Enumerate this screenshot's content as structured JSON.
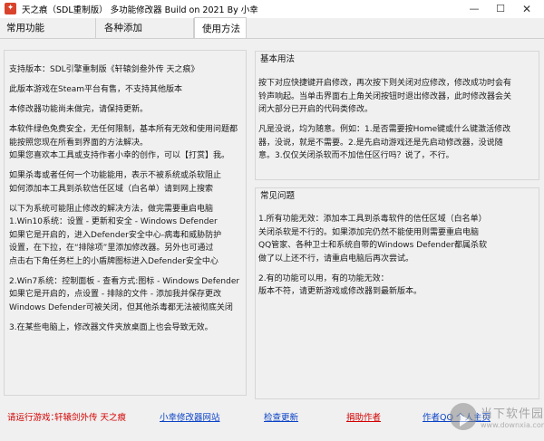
{
  "window": {
    "title": "天之痕（SDL重制版） 多功能修改器  Build on 2021 By 小幸",
    "min_glyph": "—",
    "max_glyph": "☐",
    "close_glyph": "✕"
  },
  "tabs": [
    {
      "label": "常用功能",
      "active": false
    },
    {
      "label": "各种添加",
      "active": false
    },
    {
      "label": "使用方法",
      "active": true
    }
  ],
  "left_panel": {
    "lines": [
      "支持版本：SDL引擎重制版《轩辕剑叁外传 天之痕》",
      "",
      "此版本游戏在Steam平台有售，不支持其他版本",
      "",
      "本修改器功能尚未做完，请保持更新。",
      "",
      "本软件绿色免费安全，无任何限制，基本所有无效和使用问题都",
      "能按照您现在所看到界面的方法解决。",
      "如果您喜欢本工具或支持作者小幸的创作，可以【打赏】我。",
      "",
      "如果杀毒或者任何一个功能能用，表示不被系统或杀软阻止",
      "如何添加本工具到杀软信任区域（白名单）请到网上搜索",
      "",
      "以下为系统可能阻止修改的解决方法，做完需要重启电脑",
      "1.Win10系统：设置 - 更新和安全 - Windows Defender",
      "  如果它是开启的，进入Defender安全中心-病毒和威胁防护",
      "  设置，在下拉，在“排除项”里添加修改器。另外也可通过",
      "  点击右下角任务栏上的小盾牌图标进入Defender安全中心",
      "",
      "2.Win7系统：控制面板 - 查看方式:图标 - Windows Defender",
      "  如果它是开启的，点设置 - 排除的文件 - 添加我并保存更改",
      "  Windows Defender可被关闭，但其他杀毒都无法被彻底关闭",
      "",
      "3.在某些电脑上，修改器文件夹放桌面上也会导致无效。"
    ]
  },
  "basic_usage": {
    "title": "基本用法",
    "lines": [
      "按下对应快捷键开启修改，再次按下则关闭对应修改，修改成功时会有",
      "铃声响起。当单击界面右上角关闭按钮时退出修改器，此时修改器会关",
      "闭大部分已开启的代码类修改。",
      "",
      "凡是没说，均为随意。例如：1.是否需要按Home键或什么键激活修改",
      "器，没说，就是不需要。2.是先启动游戏还是先启动修改器，没说随",
      "意。3.仅仅关闭杀软而不加信任区行吗？说了，不行。"
    ]
  },
  "faq": {
    "title": "常见问题",
    "lines": [
      "1.所有功能无效：添加本工具到杀毒软件的信任区域（白名单）",
      "  关闭杀软是不行的。如果添加完仍然不能使用则需要重启电脑",
      "  QQ管家、各种卫士和系统自带的Windows Defender都属杀软",
      "  做了以上还不行，请重启电脑后再次尝试。",
      "",
      "2.有的功能可以用，有的功能无效：",
      "  版本不符，请更新游戏或修改器到最新版本。"
    ]
  },
  "footer": {
    "running_label": "请运行游戏：",
    "game_name": "轩辕剑外传 天之痕",
    "site_link": "小幸修改器网站",
    "update_link": "检查更新",
    "donate_link": "捐助作者",
    "author_link": "作者QQ  个人主页"
  },
  "watermark": {
    "text": "当下软件园",
    "sub": "www.downxia.com"
  },
  "colors": {
    "accent_red": "#d40000",
    "link_blue": "#0b43c6",
    "background": "#f0f0f0"
  }
}
